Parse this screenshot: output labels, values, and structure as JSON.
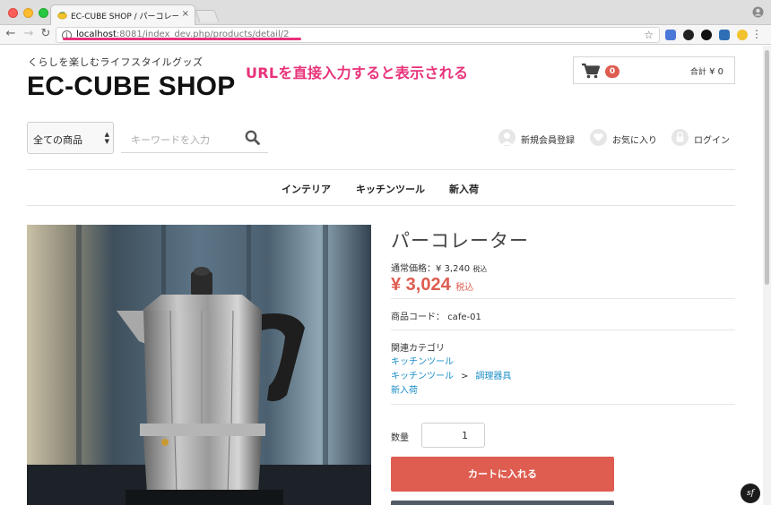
{
  "browser": {
    "tab_title": "EC-CUBE SHOP / パーコレータ",
    "tab_close": "×",
    "url_host": "localhost",
    "url_rest": ":8081/index_dev.php/products/detail/2"
  },
  "header": {
    "tagline": "くらしを楽しむライフスタイルグッズ",
    "shop_title": "EC-CUBE SHOP",
    "annotation": "URLを直接入力すると表示される",
    "cart": {
      "count": "0",
      "total_label": "合計",
      "total_value": "¥ 0"
    }
  },
  "search": {
    "category_value": "全ての商品",
    "placeholder": "キーワードを入力"
  },
  "member_links": {
    "register": "新規会員登録",
    "favorites": "お気に入り",
    "login": "ログイン"
  },
  "nav": {
    "items": [
      "インテリア",
      "キッチンツール",
      "新入荷"
    ]
  },
  "product": {
    "name": "パーコレーター",
    "normal_price_label": "通常価格：",
    "normal_price": "¥ 3,240",
    "normal_price_tax": "税込",
    "sale_price": "¥ 3,024",
    "sale_price_tax": "税込",
    "code_label": "商品コード：",
    "code": "cafe-01",
    "related_label": "関連カテゴリ",
    "categories": {
      "c1": "キッチンツール",
      "c2a": "キッチンツール",
      "c2_sep": ">",
      "c2b": "調理器具",
      "c3": "新入荷"
    },
    "qty_label": "数量",
    "qty_value": "1",
    "add_to_cart": "カートに入れる"
  },
  "colors": {
    "accent": "#de5d50",
    "link": "#1a8ec8",
    "annotation": "#e8327a"
  },
  "icons": {
    "cart": "cart-icon",
    "search": "search-icon",
    "user": "user-icon",
    "heart": "heart-icon",
    "lock": "lock-icon"
  },
  "dev_badge": "sf"
}
